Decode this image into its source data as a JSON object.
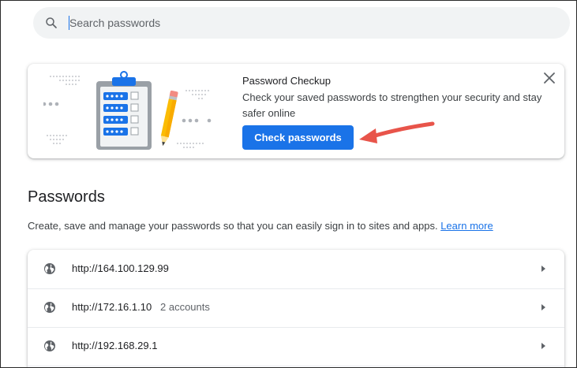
{
  "search": {
    "placeholder": "Search passwords"
  },
  "checkup": {
    "title": "Password Checkup",
    "description": "Check your saved passwords to strengthen your security and stay safer online",
    "button_label": "Check passwords"
  },
  "passwords": {
    "title": "Passwords",
    "description": "Create, save and manage your passwords so that you can easily sign in to sites and apps.",
    "learn_more": "Learn more",
    "rows": [
      {
        "site": "http://164.100.129.99",
        "accounts": ""
      },
      {
        "site": "http://172.16.1.10",
        "accounts": "2 accounts"
      },
      {
        "site": "http://192.168.29.1",
        "accounts": ""
      }
    ]
  },
  "colors": {
    "accent": "#1a73e8",
    "annotation_arrow": "#e8544a",
    "background": "#ffffff",
    "search_bg": "#f1f3f4"
  },
  "icons": [
    "search-icon",
    "close-icon",
    "globe-icon",
    "chevron-right-icon",
    "clipboard-icon",
    "pencil-icon"
  ]
}
